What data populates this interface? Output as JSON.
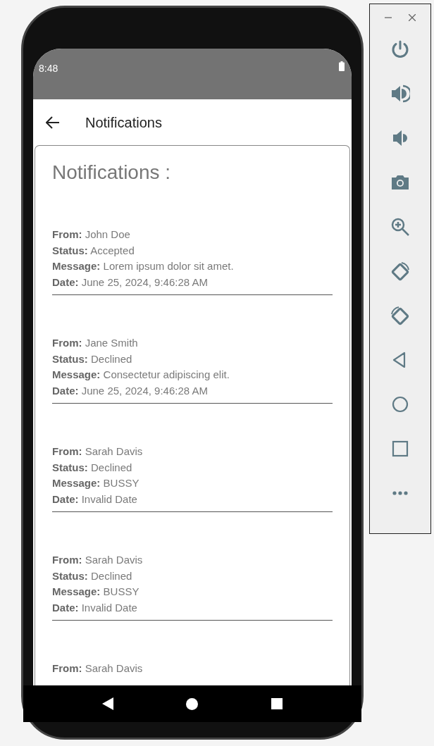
{
  "status_bar": {
    "time": "8:48"
  },
  "app_bar": {
    "title": "Notifications"
  },
  "content": {
    "heading": "Notifications :",
    "notifications": [
      {
        "lines": [
          "**From:** John Doe",
          "**Status:** Accepted",
          "**Message:** Lorem ipsum dolor sit amet.",
          "**Date:** June 25, 2024, 9:46:28 AM"
        ]
      },
      {
        "lines": [
          "**From:** Jane Smith",
          "**Status:** Declined",
          "**Message:** Consectetur adipiscing elit.",
          "**Date:** June 25, 2024, 9:46:28 AM"
        ]
      },
      {
        "lines": [
          "**From:** Sarah Davis",
          "**Status:** Declined",
          "**Message:** BUSSY",
          "**Date:** Invalid Date"
        ]
      },
      {
        "lines": [
          "**From:** Sarah Davis",
          "**Status:** Declined",
          "**Message:** BUSSY",
          "**Date:** Invalid Date"
        ]
      },
      {
        "lines": [
          "**From:** Sarah Davis"
        ]
      }
    ]
  },
  "emulator_toolbar": {
    "buttons": [
      {
        "kind": "power"
      },
      {
        "kind": "volume-up"
      },
      {
        "kind": "volume-down"
      },
      {
        "kind": "camera"
      },
      {
        "kind": "zoom"
      },
      {
        "kind": "rotate-left"
      },
      {
        "kind": "rotate-right"
      },
      {
        "kind": "back"
      },
      {
        "kind": "home"
      },
      {
        "kind": "overview"
      },
      {
        "kind": "more"
      }
    ]
  }
}
